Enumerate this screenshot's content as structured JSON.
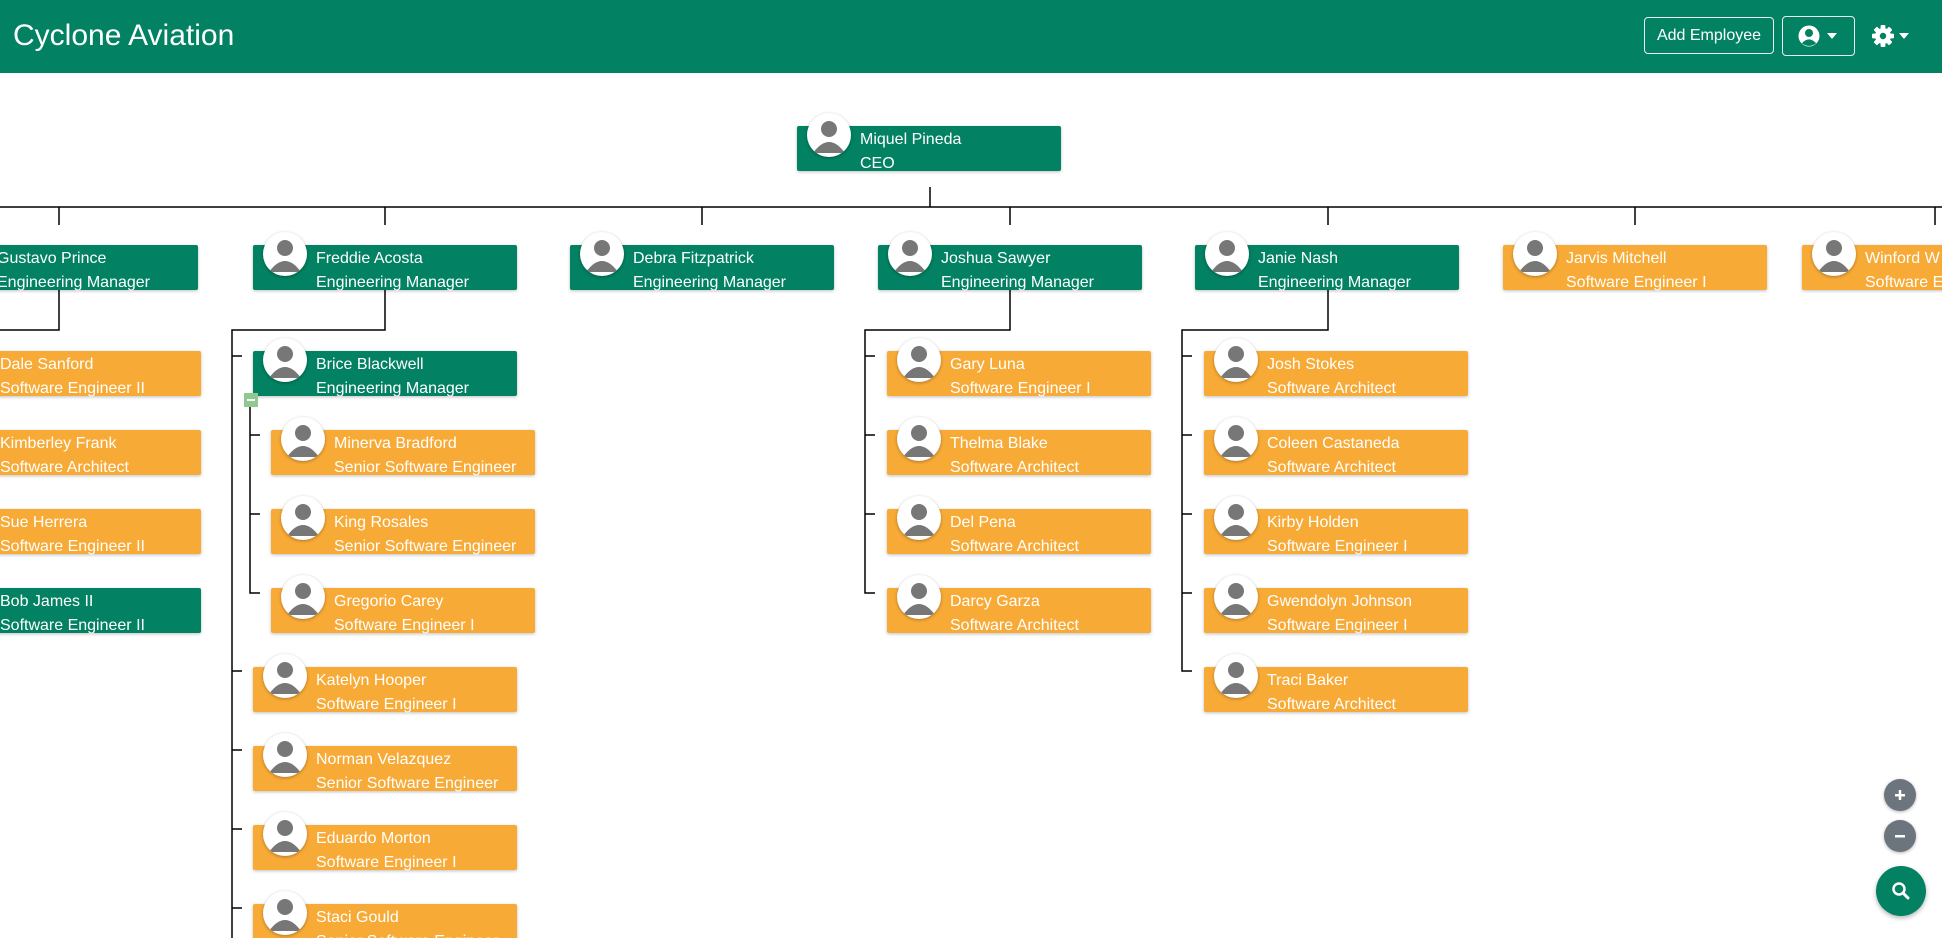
{
  "header": {
    "title": "Cyclone Aviation",
    "add_employee_label": "Add Employee",
    "user_menu_icon": "user-circle-icon",
    "settings_menu_icon": "gear-icon"
  },
  "colors": {
    "header_bg": "#028262",
    "manager_node": "#028262",
    "employee_node": "#f8aa37",
    "zoom_buttons": "#6c757d"
  },
  "org": {
    "ceo": {
      "name": "Miquel Pineda",
      "title": "CEO"
    },
    "level1": [
      {
        "name": "Gustavo Prince",
        "title": "Engineering Manager"
      },
      {
        "name": "Freddie Acosta",
        "title": "Engineering Manager"
      },
      {
        "name": "Debra Fitzpatrick",
        "title": "Engineering Manager"
      },
      {
        "name": "Joshua Sawyer",
        "title": "Engineering Manager"
      },
      {
        "name": "Janie Nash",
        "title": "Engineering Manager"
      },
      {
        "name": "Jarvis Mitchell",
        "title": "Software Engineer I"
      },
      {
        "name": "Winford W",
        "title": "Software E"
      }
    ],
    "gustavo_reports": [
      {
        "name": "Dale Sanford",
        "title": "Software Engineer II"
      },
      {
        "name": "Kimberley Frank",
        "title": "Software Architect"
      },
      {
        "name": "Sue Herrera",
        "title": "Software Engineer II"
      },
      {
        "name": "Bob James II",
        "title": "Software Engineer II"
      }
    ],
    "freddie_reports": [
      {
        "name": "Brice Blackwell",
        "title": "Engineering Manager"
      },
      {
        "name": "Katelyn Hooper",
        "title": "Software Engineer I"
      },
      {
        "name": "Norman Velazquez",
        "title": "Senior Software Engineer"
      },
      {
        "name": "Eduardo Morton",
        "title": "Software Engineer I"
      },
      {
        "name": "Staci Gould",
        "title": "Senior Software Engineer"
      }
    ],
    "brice_reports": [
      {
        "name": "Minerva Bradford",
        "title": "Senior Software Engineer"
      },
      {
        "name": "King Rosales",
        "title": "Senior Software Engineer"
      },
      {
        "name": "Gregorio Carey",
        "title": "Software Engineer I"
      }
    ],
    "joshua_reports": [
      {
        "name": "Gary Luna",
        "title": "Software Engineer I"
      },
      {
        "name": "Thelma Blake",
        "title": "Software Architect"
      },
      {
        "name": "Del Pena",
        "title": "Software Architect"
      },
      {
        "name": "Darcy Garza",
        "title": "Software Architect"
      }
    ],
    "janie_reports": [
      {
        "name": "Josh Stokes",
        "title": "Software Architect"
      },
      {
        "name": "Coleen Castaneda",
        "title": "Software Architect"
      },
      {
        "name": "Kirby Holden",
        "title": "Software Engineer I"
      },
      {
        "name": "Gwendolyn Johnson",
        "title": "Software Engineer I"
      },
      {
        "name": "Traci Baker",
        "title": "Software Architect"
      }
    ]
  },
  "controls": {
    "zoom_in_icon": "plus-icon",
    "zoom_out_icon": "minus-icon",
    "search_icon": "search-icon",
    "collapse_icon": "minus-icon"
  }
}
